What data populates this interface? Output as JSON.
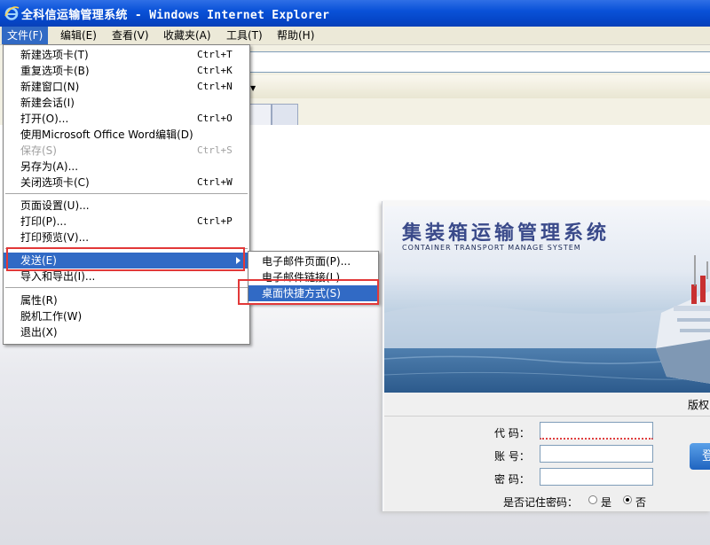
{
  "window": {
    "title": "全科信运输管理系统 - Windows Internet Explorer",
    "icon": "ie-icon"
  },
  "menubar": [
    {
      "label": "文件(F)"
    },
    {
      "label": "编辑(E)"
    },
    {
      "label": "查看(V)"
    },
    {
      "label": "收藏夹(A)"
    },
    {
      "label": "工具(T)"
    },
    {
      "label": "帮助(H)"
    }
  ],
  "file_menu": [
    {
      "label": "新建选项卡(T)",
      "shortcut": "Ctrl+T"
    },
    {
      "label": "重复选项卡(B)",
      "shortcut": "Ctrl+K"
    },
    {
      "label": "新建窗口(N)",
      "shortcut": "Ctrl+N"
    },
    {
      "label": "新建会话(I)",
      "shortcut": ""
    },
    {
      "label": "打开(O)...",
      "shortcut": "Ctrl+O"
    },
    {
      "label": "使用Microsoft Office Word编辑(D)",
      "shortcut": ""
    },
    {
      "label": "保存(S)",
      "shortcut": "Ctrl+S",
      "disabled": true
    },
    {
      "label": "另存为(A)...",
      "shortcut": ""
    },
    {
      "label": "关闭选项卡(C)",
      "shortcut": "Ctrl+W"
    },
    {
      "label": "页面设置(U)...",
      "shortcut": ""
    },
    {
      "label": "打印(P)...",
      "shortcut": "Ctrl+P"
    },
    {
      "label": "打印预览(V)...",
      "shortcut": ""
    },
    {
      "label": "发送(E)",
      "shortcut": "",
      "submenu": true,
      "highlighted": true
    },
    {
      "label": "导入和导出(I)...",
      "shortcut": ""
    },
    {
      "label": "属性(R)",
      "shortcut": ""
    },
    {
      "label": "脱机工作(W)",
      "shortcut": ""
    },
    {
      "label": "退出(X)",
      "shortcut": ""
    }
  ],
  "send_submenu": [
    {
      "label": "电子邮件页面(P)..."
    },
    {
      "label": "电子邮件链接(L)..."
    },
    {
      "label": "桌面快捷方式(S)",
      "highlighted": true
    }
  ],
  "login": {
    "system_title": "集装箱运输管理系统",
    "system_subtitle": "CONTAINER TRANSPORT MANAGE SYSTEM",
    "copyright": "版权",
    "code_label": "代  码：",
    "account_label": "账  号：",
    "password_label": "密  码：",
    "code_value": "",
    "account_value": "",
    "password_value": "",
    "login_button": "登",
    "remember_label": "是否记住密码：",
    "remember_yes": "是",
    "remember_no": "否",
    "remember_selected": "否"
  },
  "colors": {
    "titlebar": "#0a52d8",
    "highlight": "#316ac5",
    "annotation": "#e23838"
  }
}
